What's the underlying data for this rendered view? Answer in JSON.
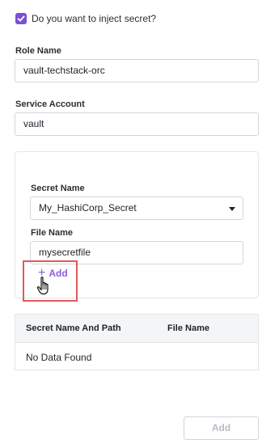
{
  "inject": {
    "label": "Do you want to inject secret?",
    "checked": true
  },
  "role": {
    "label": "Role Name",
    "value": "vault-techstack-orc"
  },
  "service_account": {
    "label": "Service Account",
    "value": "vault"
  },
  "secret": {
    "name_label": "Secret Name",
    "name_value": "My_HashiCorp_Secret",
    "file_label": "File Name",
    "file_value": "mysecretfile",
    "add_label": "Add"
  },
  "table": {
    "columns": [
      "Secret Name And Path",
      "File Name"
    ],
    "empty_text": "No Data Found"
  },
  "footer": {
    "add_button": "Add"
  },
  "colors": {
    "accent": "#8e5ce0",
    "highlight": "#e05a5a"
  }
}
